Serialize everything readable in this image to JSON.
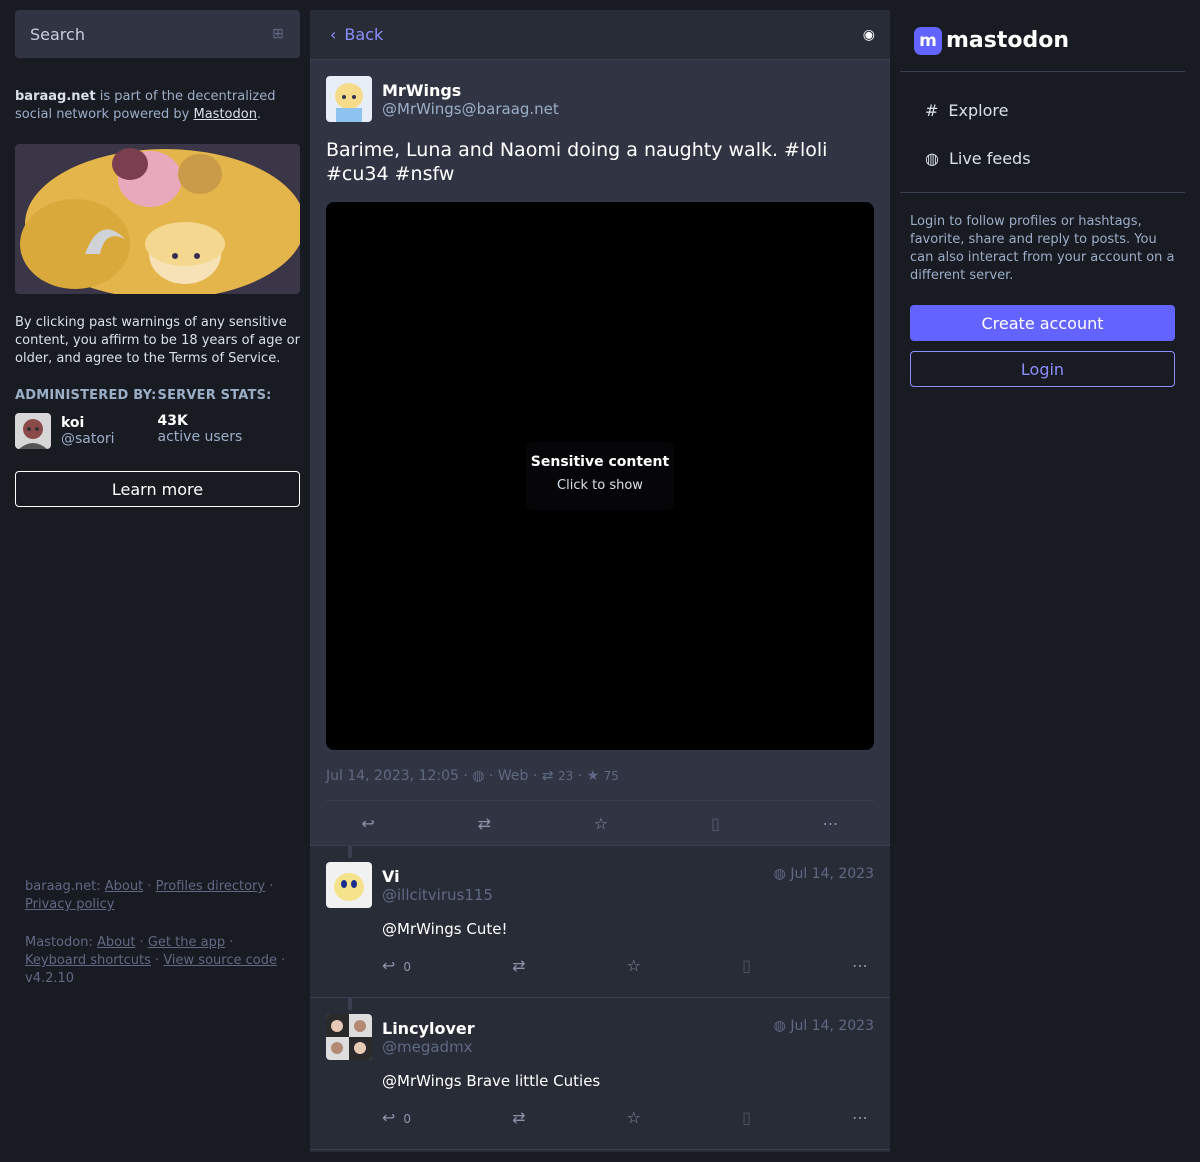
{
  "search": {
    "placeholder": "Search"
  },
  "about": {
    "server": "baraag.net",
    "text": " is part of the decentralized social network powered by ",
    "link": "Mastodon",
    "end": "."
  },
  "warning": "By clicking past warnings of any sensitive content, you affirm to be 18 years of age or older, and agree to the Terms of Service.",
  "admin": {
    "heading": "ADMINISTERED BY:",
    "name": "koi",
    "handle": "@satori"
  },
  "stats": {
    "heading": "SERVER STATS:",
    "value": "43K",
    "label": "active users"
  },
  "learn_more": "Learn more",
  "footer": {
    "server_label": "baraag.net:",
    "about": "About",
    "profiles": "Profiles directory",
    "privacy": "Privacy policy",
    "mastodon_label": "Mastodon:",
    "m_about": "About",
    "get_app": "Get the app",
    "keyboard": "Keyboard shortcuts",
    "source": "View source code",
    "version": "v4.2.10"
  },
  "header": {
    "back": "Back"
  },
  "post": {
    "author": "MrWings",
    "handle": "@MrWings@baraag.net",
    "text": "Barime, Luna and Naomi doing a naughty walk. #loli #cu34 #nsfw",
    "sensitive_title": "Sensitive content",
    "sensitive_sub": "Click to show",
    "date": "Jul 14, 2023, 12:05",
    "app": "Web",
    "boosts": "23",
    "favs": "75"
  },
  "replies": [
    {
      "name": "Vi",
      "handle": "@illcitvirus115",
      "date": "Jul 14, 2023",
      "text": "@MrWings Cute!",
      "count": "0"
    },
    {
      "name": "Lincylover",
      "handle": "@megadmx",
      "date": "Jul 14, 2023",
      "text": "@MrWings Brave little Cuties",
      "count": "0"
    }
  ],
  "right": {
    "brand": "mastodon",
    "explore": "Explore",
    "live": "Live feeds",
    "promo": "Login to follow profiles or hashtags, favorite, share and reply to posts. You can also interact from your account on a different server.",
    "create": "Create account",
    "login": "Login"
  }
}
